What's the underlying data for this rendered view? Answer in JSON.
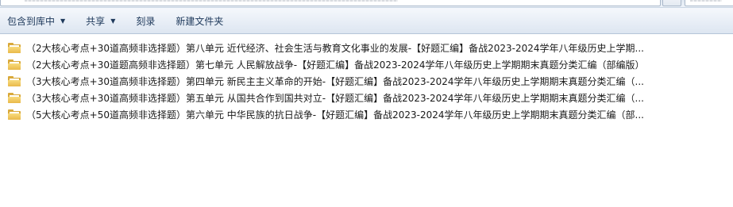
{
  "toolbar": {
    "include_in_library": "包含到库中",
    "share": "共享",
    "burn": "刻录",
    "new_folder": "新建文件夹"
  },
  "files": [
    {
      "name": "（2大核心考点+30道高频非选择题）第八单元 近代经济、社会生活与教育文化事业的发展-【好题汇编】备战2023-2024学年八年级历史上学期..."
    },
    {
      "name": "（2大核心考点+30道题高频非选择题）第七单元 人民解放战争-【好题汇编】备战2023-2024学年八年级历史上学期期末真题分类汇编（部编版）"
    },
    {
      "name": "（3大核心考点+30道高频非选择题）第四单元 新民主主义革命的开始-【好题汇编】备战2023-2024学年八年级历史上学期期末真题分类汇编（..."
    },
    {
      "name": "（3大核心考点+30道高频非选择题）第五单元 从国共合作到国共对立-【好题汇编】备战2023-2024学年八年级历史上学期期末真题分类汇编（..."
    },
    {
      "name": "（5大核心考点+50道高频非选择题）第六单元 中华民族的抗日战争-【好题汇编】备战2023-2024学年八年级历史上学期期末真题分类汇编（部..."
    }
  ]
}
